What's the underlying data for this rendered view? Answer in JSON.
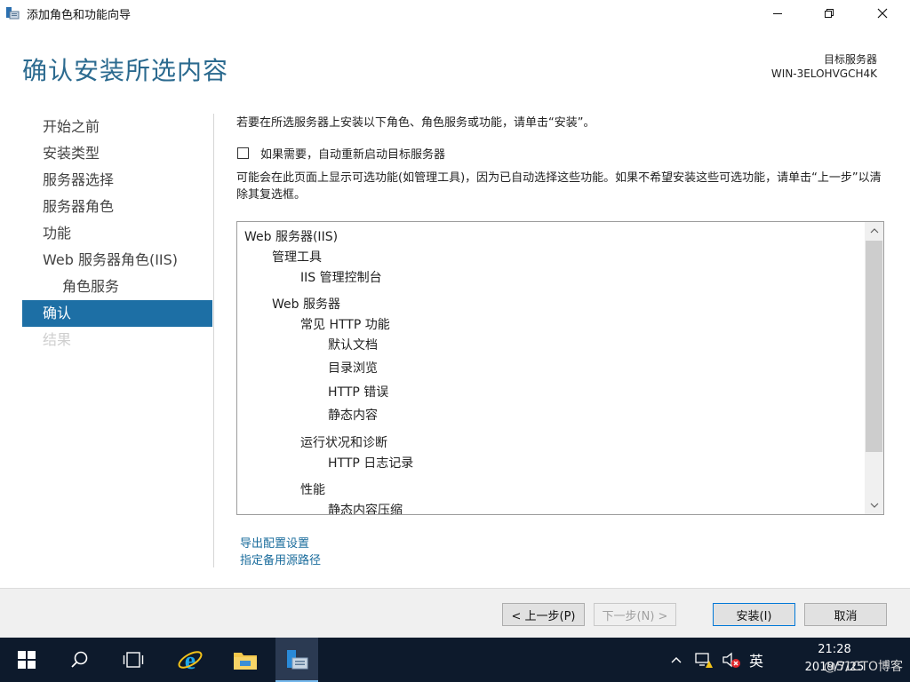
{
  "window": {
    "title": "添加角色和功能向导",
    "page_title": "确认安装所选内容",
    "target_server_label": "目标服务器",
    "target_server_name": "WIN-3ELOHVGCH4K"
  },
  "sidebar": {
    "items": [
      {
        "label": "开始之前",
        "state": "normal"
      },
      {
        "label": "安装类型",
        "state": "normal"
      },
      {
        "label": "服务器选择",
        "state": "normal"
      },
      {
        "label": "服务器角色",
        "state": "normal"
      },
      {
        "label": "功能",
        "state": "normal"
      },
      {
        "label": "Web 服务器角色(IIS)",
        "state": "normal"
      },
      {
        "label": "角色服务",
        "state": "normal"
      },
      {
        "label": "确认",
        "state": "active"
      },
      {
        "label": "结果",
        "state": "disabled"
      }
    ]
  },
  "content": {
    "intro": "若要在所选服务器上安装以下角色、角色服务或功能，请单击“安装”。",
    "restart_checkbox_label": "如果需要，自动重新启动目标服务器",
    "restart_checked": false,
    "description": "可能会在此页面上显示可选功能(如管理工具)，因为已自动选择这些功能。如果不希望安装这些可选功能，请单击“上一步”以清除其复选框。",
    "tree": [
      "Web 服务器(IIS)",
      "管理工具",
      "IIS 管理控制台",
      "Web 服务器",
      "常见 HTTP 功能",
      "默认文档",
      "目录浏览",
      "HTTP 错误",
      "静态内容",
      "运行状况和诊断",
      "HTTP 日志记录",
      "性能",
      "静态内容压缩"
    ],
    "export_link": "导出配置设置",
    "alt_source_link": "指定备用源路径"
  },
  "footer": {
    "prev_label": "< 上一步(P)",
    "next_label": "下一步(N) >",
    "install_label": "安装(I)",
    "cancel_label": "取消"
  },
  "taskbar": {
    "ime_label": "英",
    "time": "21:28",
    "date": "2019/7/25",
    "watermark": "@51CTO博客"
  },
  "colors": {
    "accent": "#1d6fa5",
    "title": "#2b6a8f",
    "link": "#1a6c9c",
    "taskbar": "#0d1a2c"
  }
}
